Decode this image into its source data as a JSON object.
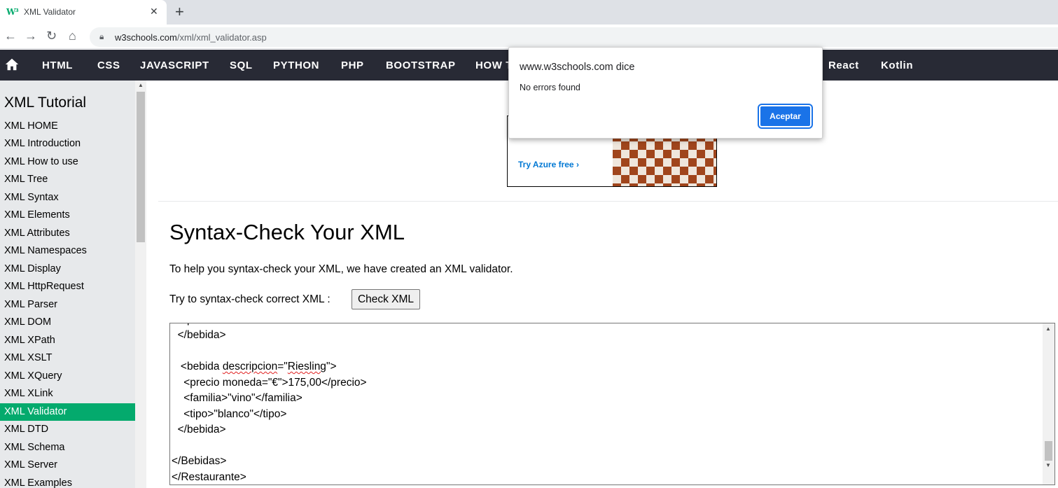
{
  "browser": {
    "tab_title": "XML Validator",
    "tab_favicon": "W³",
    "url_host": "w3schools.com",
    "url_path": "/xml/xml_validator.asp"
  },
  "topnav": {
    "items": [
      "HTML",
      "CSS",
      "JAVASCRIPT",
      "SQL",
      "PYTHON",
      "PHP",
      "BOOTSTRAP",
      "HOW TO",
      "React",
      "Kotlin"
    ]
  },
  "sidebar": {
    "title": "XML Tutorial",
    "items": [
      "XML HOME",
      "XML Introduction",
      "XML How to use",
      "XML Tree",
      "XML Syntax",
      "XML Elements",
      "XML Attributes",
      "XML Namespaces",
      "XML Display",
      "XML HttpRequest",
      "XML Parser",
      "XML DOM",
      "XML XPath",
      "XML XSLT",
      "XML XQuery",
      "XML XLink",
      "XML Validator",
      "XML DTD",
      "XML Schema",
      "XML Server",
      "XML Examples"
    ],
    "active": "XML Validator"
  },
  "ad": {
    "cta": "Try Azure free",
    "cta_icon": "chevron-right-icon"
  },
  "main": {
    "heading": "Syntax-Check Your XML",
    "intro": "To help you syntax-check your XML, we have created an XML validator.",
    "try_text": "Try to syntax-check correct XML :",
    "check_button": "Check XML"
  },
  "code": {
    "lines": [
      "  </bebida>",
      "",
      "   <bebida descripcion=\"Riesling\">",
      "    <precio moneda=\"€\">175,00</precio>",
      "    <familia>\"vino\"</familia>",
      "    <tipo>\"blanco\"</tipo>",
      "  </bebida>",
      "",
      "</Bebidas>",
      "</Restaurante>"
    ]
  },
  "dialog": {
    "origin": "www.w3schools.com dice",
    "message": "No errors found",
    "ok_label": "Aceptar"
  },
  "colors": {
    "accent": "#04aa6d",
    "topnav_bg": "#282a35",
    "sidebar_bg": "#e7e9eb",
    "dialog_button": "#1a73e8"
  }
}
